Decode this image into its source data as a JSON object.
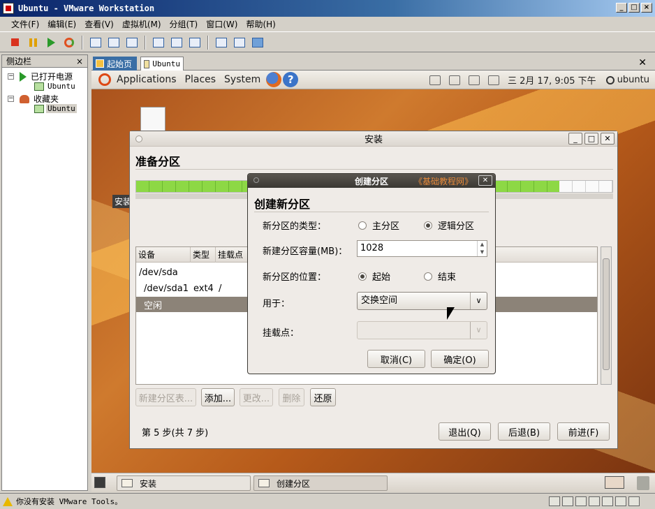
{
  "window": {
    "title": "Ubuntu - VMware Workstation"
  },
  "menubar": [
    "文件(F)",
    "编辑(E)",
    "查看(V)",
    "虚拟机(M)",
    "分组(T)",
    "窗口(W)",
    "帮助(H)"
  ],
  "sidebar": {
    "title": "侧边栏",
    "powered_on": "已打开电源",
    "vm1": "Ubuntu",
    "favorites": "收藏夹",
    "vm2": "Ubuntu"
  },
  "tabs": {
    "home": "起始页",
    "ubuntu": "Ubuntu"
  },
  "gnome_panel": {
    "applications": "Applications",
    "places": "Places",
    "system": "System",
    "clock": "三 2月 17, 9:05 下午",
    "user": "ubuntu"
  },
  "desktop": {
    "icon_label": "安装"
  },
  "installer": {
    "title": "安装",
    "heading": "准备分区",
    "columns": [
      "设备",
      "类型",
      "挂载点"
    ],
    "rows": [
      {
        "device": "/dev/sda",
        "type": "",
        "mount": ""
      },
      {
        "device": "/dev/sda1",
        "type": "ext4",
        "mount": "/"
      },
      {
        "device": "空闲",
        "type": "",
        "mount": ""
      }
    ],
    "btn_new_table": "新建分区表...",
    "btn_add": "添加...",
    "btn_change": "更改...",
    "btn_delete": "删除",
    "btn_revert": "还原",
    "step": "第 5 步(共 7 步)",
    "btn_quit": "退出(Q)",
    "btn_back": "后退(B)",
    "btn_forward": "前进(F)"
  },
  "dialog": {
    "title": "创建分区",
    "watermark": "《基础教程网》",
    "heading": "创建新分区",
    "type_label": "新分区的类型：",
    "type_primary": "主分区",
    "type_logical": "逻辑分区",
    "type_selected": "逻辑分区",
    "size_label": "新建分区容量(MB)：",
    "size_value": "1028",
    "location_label": "新分区的位置：",
    "location_begin": "起始",
    "location_end": "结束",
    "location_selected": "起始",
    "use_label": "用于：",
    "use_value": "交换空间",
    "mount_label": "挂载点：",
    "mount_value": "",
    "cancel": "取消(C)",
    "ok": "确定(O)"
  },
  "taskbar": {
    "task1": "安装",
    "task2": "创建分区"
  },
  "statusbar": {
    "text": "你没有安装 VMware Tools。"
  }
}
